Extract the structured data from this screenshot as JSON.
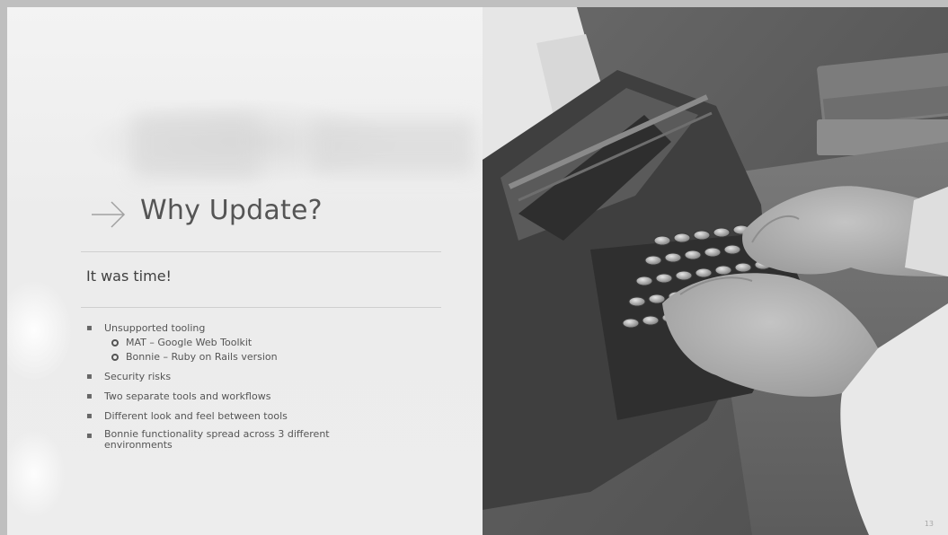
{
  "slide": {
    "title": "Why Update?",
    "subtitle": "It was time!",
    "bullets": [
      {
        "text": "Unsupported tooling",
        "subs": [
          "MAT – Google Web Toolkit",
          "Bonnie – Ruby on Rails version"
        ]
      },
      {
        "text": "Security risks"
      },
      {
        "text": "Two separate tools and workflows"
      },
      {
        "text": "Different look and feel between tools"
      },
      {
        "text": "Bonnie functionality spread across 3 different environments"
      }
    ],
    "page_number": "13"
  },
  "icons": {
    "title_icon": "arrow-right-icon",
    "bullet_icon": "square-bullet-icon",
    "sub_bullet_icon": "hollow-circle-icon"
  },
  "image": "typewriter-hands-photo"
}
